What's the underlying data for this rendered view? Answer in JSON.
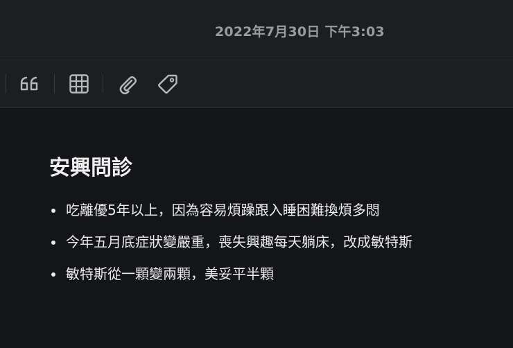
{
  "header": {
    "timestamp": "2022年7月30日 下午3:03"
  },
  "toolbar": {
    "buttons": [
      {
        "icon": "quote-icon",
        "label": "Quote"
      },
      {
        "icon": "table-icon",
        "label": "Table"
      },
      {
        "icon": "paperclip-icon",
        "label": "Attachment"
      },
      {
        "icon": "tag-icon",
        "label": "Tag"
      }
    ]
  },
  "note": {
    "title": "安興問診",
    "bullets": [
      "吃離優5年以上，因為容易煩躁跟入睡困難換煩多悶",
      "今年五月底症狀變嚴重，喪失興趣每天躺床，改成敏特斯",
      "敏特斯從一顆變兩顆，美妥平半顆"
    ]
  },
  "colors": {
    "background": "#141518",
    "toolbar": "#1d1e21",
    "text": "#ececed",
    "muted": "#9a9b9f"
  }
}
